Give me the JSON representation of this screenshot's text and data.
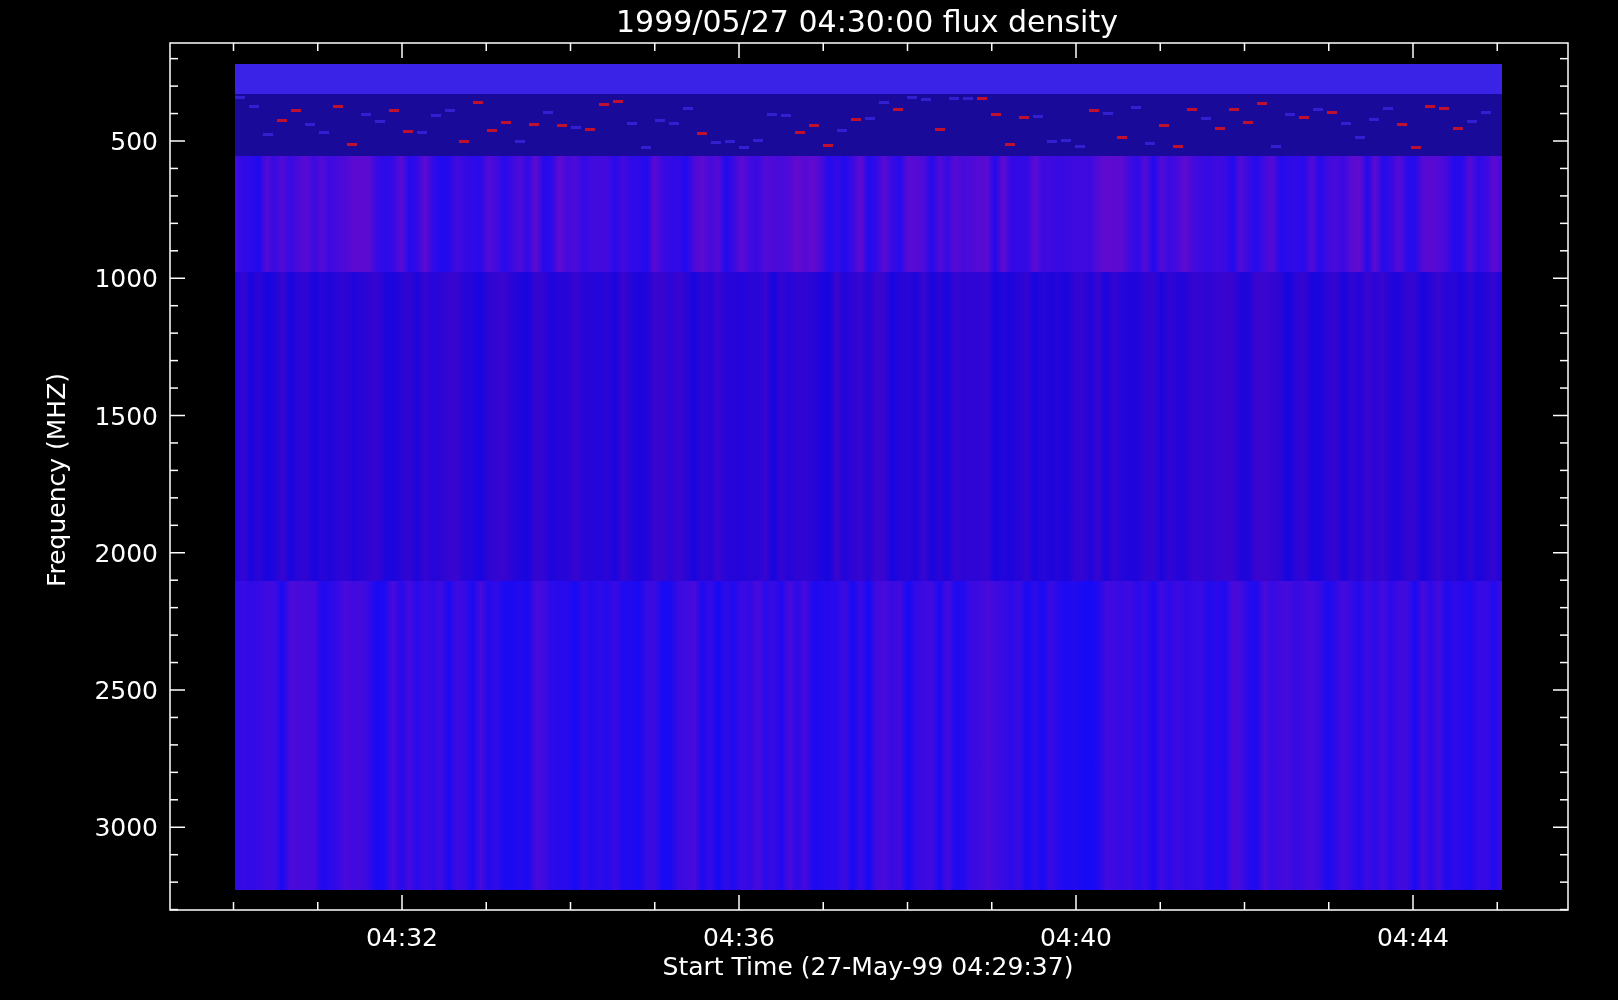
{
  "plot": {
    "title": "1999/05/27 04:30:00 flux density",
    "xlabel": "Start Time (27-May-99 04:29:37)",
    "ylabel": "Frequency (MHZ)",
    "yticks": [
      "500",
      "1000",
      "1500",
      "2000",
      "2500",
      "3000"
    ],
    "xticks": [
      "04:32",
      "04:36",
      "04:40",
      "04:44"
    ]
  }
}
